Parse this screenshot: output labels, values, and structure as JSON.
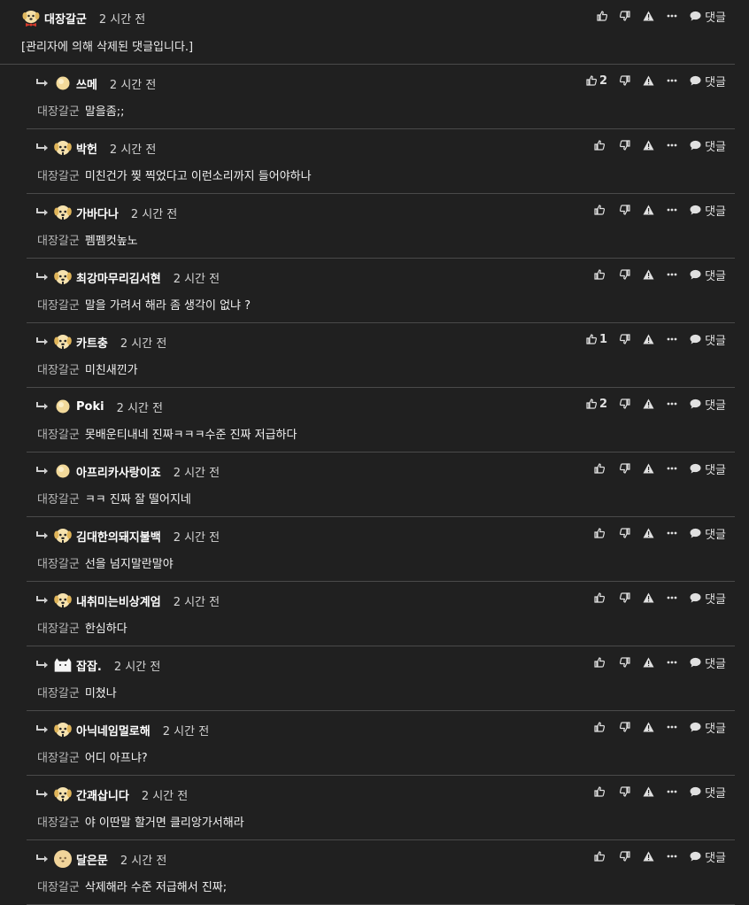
{
  "parent": {
    "nick": "대장갈군",
    "time": "2 시간 전",
    "text": "[관리자에 의해 삭제된 댓글입니다.]",
    "avatar": "puppy-bowtie-icon"
  },
  "actions": {
    "reply_label": "댓글",
    "like_icon": "thumbs-up-icon",
    "dislike_icon": "thumbs-down-icon",
    "report_icon": "warning-icon",
    "more_icon": "more-dots-icon",
    "reply_icon": "speech-bubble-icon"
  },
  "replies": [
    {
      "nick": "쓰메",
      "time": "2 시간 전",
      "mention": "대장갈군",
      "text": "말을좀;;",
      "likes": "2",
      "avatar": "beige-circle"
    },
    {
      "nick": "박헌",
      "time": "2 시간 전",
      "mention": "대장갈군",
      "text": "미친건가 찢 찍었다고 이런소리까지 들어야하나",
      "likes": "",
      "avatar": "puppy"
    },
    {
      "nick": "가바다나",
      "time": "2 시간 전",
      "mention": "대장갈군",
      "text": "펨펨컷높노",
      "likes": "",
      "avatar": "puppy"
    },
    {
      "nick": "최강마무리김서현",
      "time": "2 시간 전",
      "mention": "대장갈군",
      "text": "말을 가려서 해라 좀 생각이 없냐 ?",
      "likes": "",
      "avatar": "puppy"
    },
    {
      "nick": "카트충",
      "time": "2 시간 전",
      "mention": "대장갈군",
      "text": "미친새낀가",
      "likes": "1",
      "avatar": "puppy"
    },
    {
      "nick": "Poki",
      "time": "2 시간 전",
      "mention": "대장갈군",
      "text": "못배운티내네 진짜ㅋㅋㅋ수준 진짜 저급하다",
      "likes": "2",
      "avatar": "beige-circle"
    },
    {
      "nick": "아프리카사랑이죠",
      "time": "2 시간 전",
      "mention": "대장갈군",
      "text": "ㅋㅋ 진짜 잘 떨어지네",
      "likes": "",
      "avatar": "beige-circle"
    },
    {
      "nick": "김대한의돼지불백",
      "time": "2 시간 전",
      "mention": "대장갈군",
      "text": "선을 넘지말란말야",
      "likes": "",
      "avatar": "puppy"
    },
    {
      "nick": "내취미는비상계엄",
      "time": "2 시간 전",
      "mention": "대장갈군",
      "text": "한심하다",
      "likes": "",
      "avatar": "puppy"
    },
    {
      "nick": "잡잡.",
      "time": "2 시간 전",
      "mention": "대장갈군",
      "text": "미쳤나",
      "likes": "",
      "avatar": "white-creature"
    },
    {
      "nick": "아닉네임멀로해",
      "time": "2 시간 전",
      "mention": "대장갈군",
      "text": "어디 아프냐?",
      "likes": "",
      "avatar": "puppy"
    },
    {
      "nick": "간괘삽니다",
      "time": "2 시간 전",
      "mention": "대장갈군",
      "text": "야 이딴말 할거면 클리앙가서해라",
      "likes": "",
      "avatar": "puppy"
    },
    {
      "nick": "달은문",
      "time": "2 시간 전",
      "mention": "대장갈군",
      "text": "삭제해라 수준 저급해서 진짜;",
      "likes": "",
      "avatar": "puppy-blur"
    }
  ],
  "colors": {
    "background": "#202020",
    "divider": "#4a4a4a",
    "text": "#e6e6e6"
  }
}
